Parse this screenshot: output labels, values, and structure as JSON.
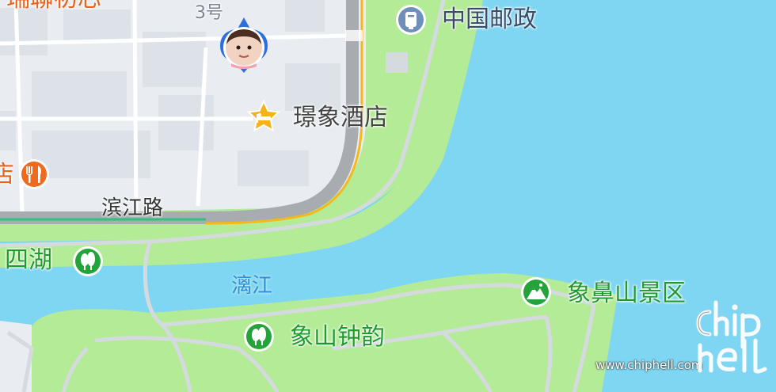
{
  "map": {
    "roads": {
      "binjiang": "滨江路"
    },
    "water": {
      "river": "漓江"
    },
    "pois": {
      "china_post": "中国邮政",
      "hotel": "璟象酒店",
      "xiangbishan": "象鼻山景区",
      "xiangshan_zhongyun": "象山钟韵",
      "sihu": "四湖",
      "restaurant_partial": "店",
      "top_partial_label": "瑞聯初芯",
      "building_number": "3号"
    },
    "colors": {
      "water": "#7fd6f2",
      "park": "#b4eb96",
      "city_block": "#e9edf2",
      "road_main": "#a8abb0",
      "road_highlight": "#f5b818",
      "poi_green": "#24a33a",
      "poi_post": "#6e8fb9",
      "poi_hotel": "#f7b21a",
      "poi_food": "#ef6a1e"
    },
    "icons": [
      "post-box-icon",
      "hotel-bed-icon",
      "mountain-icon",
      "tree-icon",
      "fork-knife-icon",
      "location-pin-icon"
    ]
  },
  "watermark": {
    "url": "www.chiphell.com",
    "logo_text": "chiphell"
  }
}
